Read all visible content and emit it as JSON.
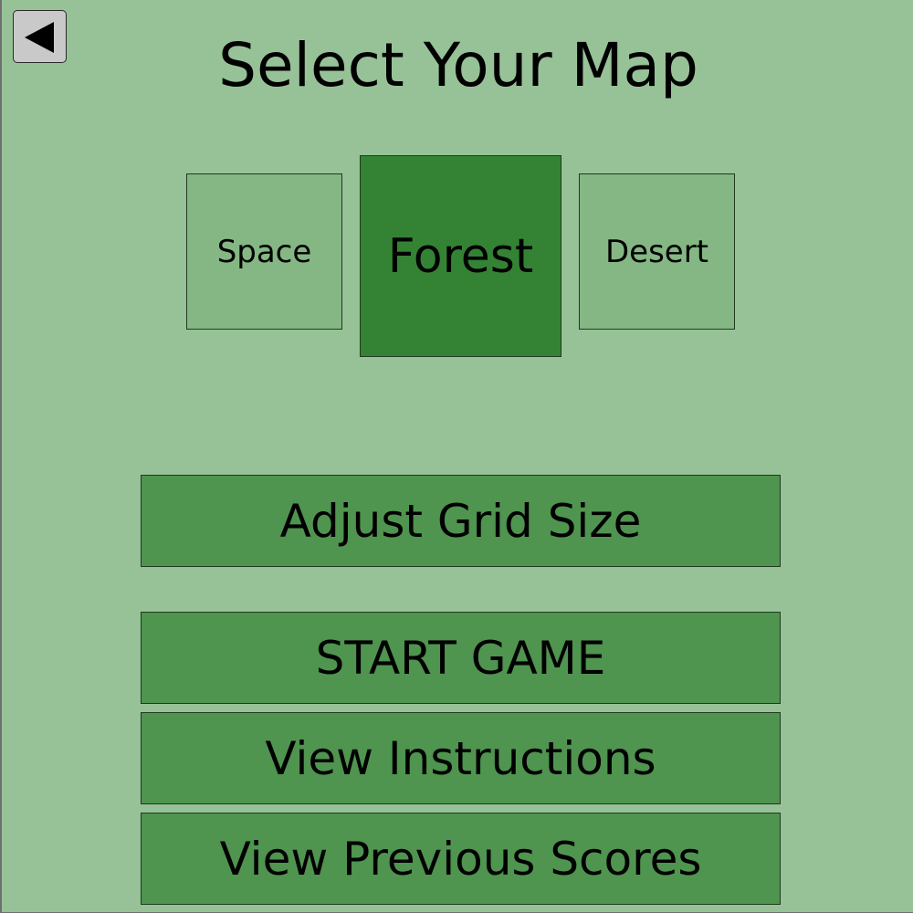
{
  "title": "Select Your Map",
  "back_button": {
    "icon": "back-arrow-icon"
  },
  "maps": {
    "selected": "Forest",
    "items": [
      {
        "label": "Space",
        "selected": false
      },
      {
        "label": "Forest",
        "selected": true
      },
      {
        "label": "Desert",
        "selected": false
      }
    ]
  },
  "buttons": {
    "adjust_grid": "Adjust Grid Size",
    "start_game": "START GAME",
    "view_instructions": "View Instructions",
    "view_scores": "View Previous Scores"
  },
  "colors": {
    "background": "#97c297",
    "tile_unselected": "#84b784",
    "tile_selected": "#348334",
    "button": "#4f944f",
    "back_button": "#c9c9c9"
  }
}
